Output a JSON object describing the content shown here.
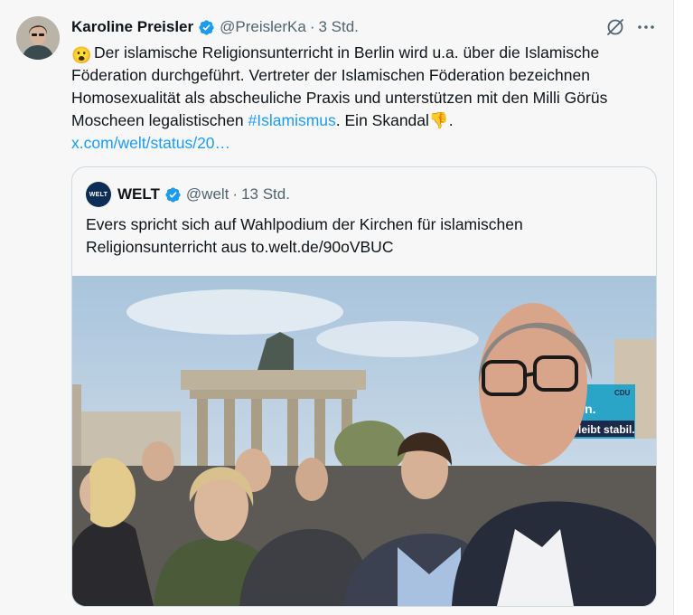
{
  "post": {
    "author_name": "Karoline Preisler",
    "handle": "@PreislerKa",
    "separator": "·",
    "time": "3 Std.",
    "text_emoji": "😮",
    "text_main": "Der islamische Religionsunterricht in Berlin wird u.a. über die Islamische Föderation durchgeführt. Vertreter der Islamischen Föderation bezeichnen Homosexualität als abscheuliche Praxis und unterstützen mit den Milli Görüs Moscheen legalistischen ",
    "hashtag": "#Islamismus",
    "text_after": ". Ein Skandal",
    "text_emoji2": "👎",
    "text_end": ".",
    "link": "x.com/welt/status/20…"
  },
  "quote": {
    "logo_text": "WELT",
    "author_name": "WELT",
    "handle": "@welt",
    "separator": "·",
    "time": "13 Std.",
    "text": "Evers spricht sich auf Wahlpodium der Kirchen für islamischen Religionsunterricht aus to.welt.de/90oVBUC"
  },
  "photo_banner": {
    "line1": "Berlin.",
    "line2": "leibt stabil.",
    "party": "CDU"
  },
  "colors": {
    "accent": "#1d9bf0",
    "text": "#0f1419",
    "secondary": "#536471",
    "verified": "#1d9bf0"
  },
  "icons": [
    "verified-badge-icon",
    "grok-icon",
    "more-icon",
    "welt-logo"
  ]
}
